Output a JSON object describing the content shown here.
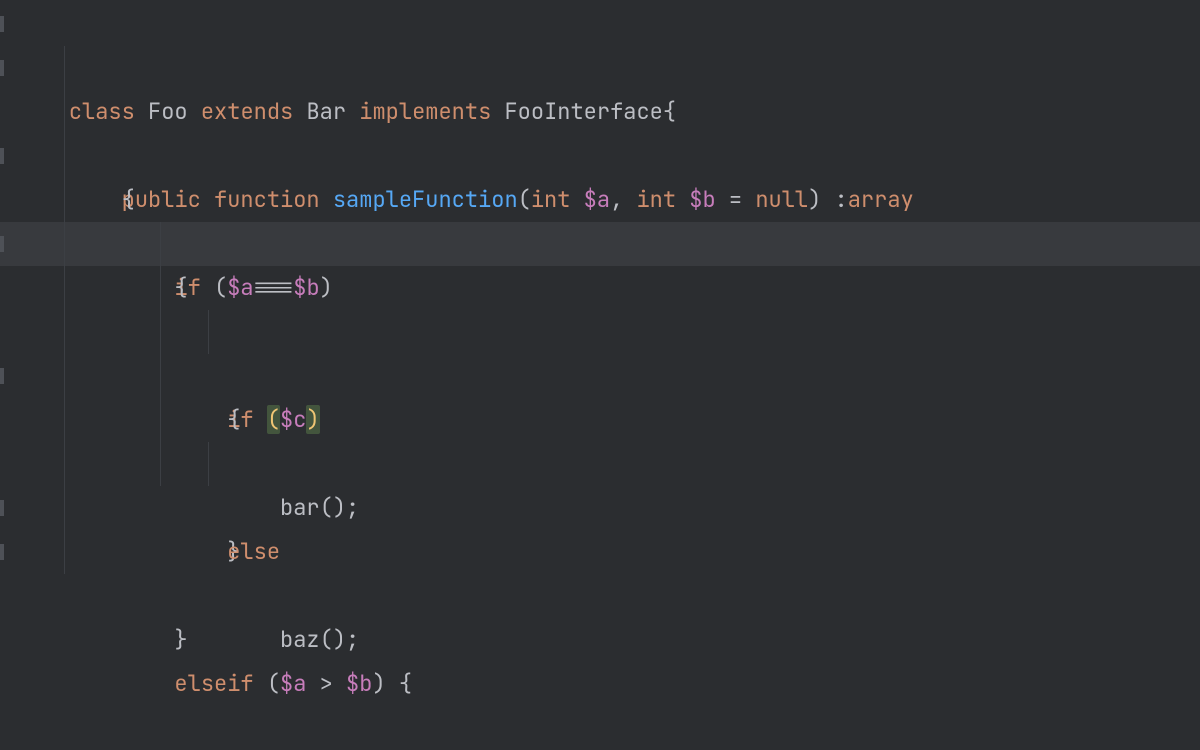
{
  "code": {
    "kw_class": "class",
    "cls_foo": "Foo",
    "kw_extends": "extends",
    "cls_bar": "Bar",
    "kw_implements": "implements",
    "cls_foointerface": "FooInterface",
    "brace_open": "{",
    "brace_close": "}",
    "kw_public": "public",
    "kw_function": "function",
    "fn_sample": "sampleFunction",
    "paren_open": "(",
    "paren_close": ")",
    "kw_int": "int",
    "var_a": "$a",
    "var_b": "$b",
    "var_c": "$c",
    "comma_sp": ", ",
    "op_assign": " = ",
    "kw_null": "null",
    "sp_colon": " :",
    "kw_array": "array",
    "kw_if": "if",
    "kw_else": "else",
    "kw_elseif": "elseif",
    "op_identity": "===",
    "op_gt": " > ",
    "fn_bar": "bar",
    "fn_baz": "baz",
    "unit_call": "()",
    "semi": ";",
    "space": " ",
    "sp4": "    ",
    "sp8": "        ",
    "sp12": "            ",
    "sp16": "                ",
    "sp20": "                    "
  }
}
